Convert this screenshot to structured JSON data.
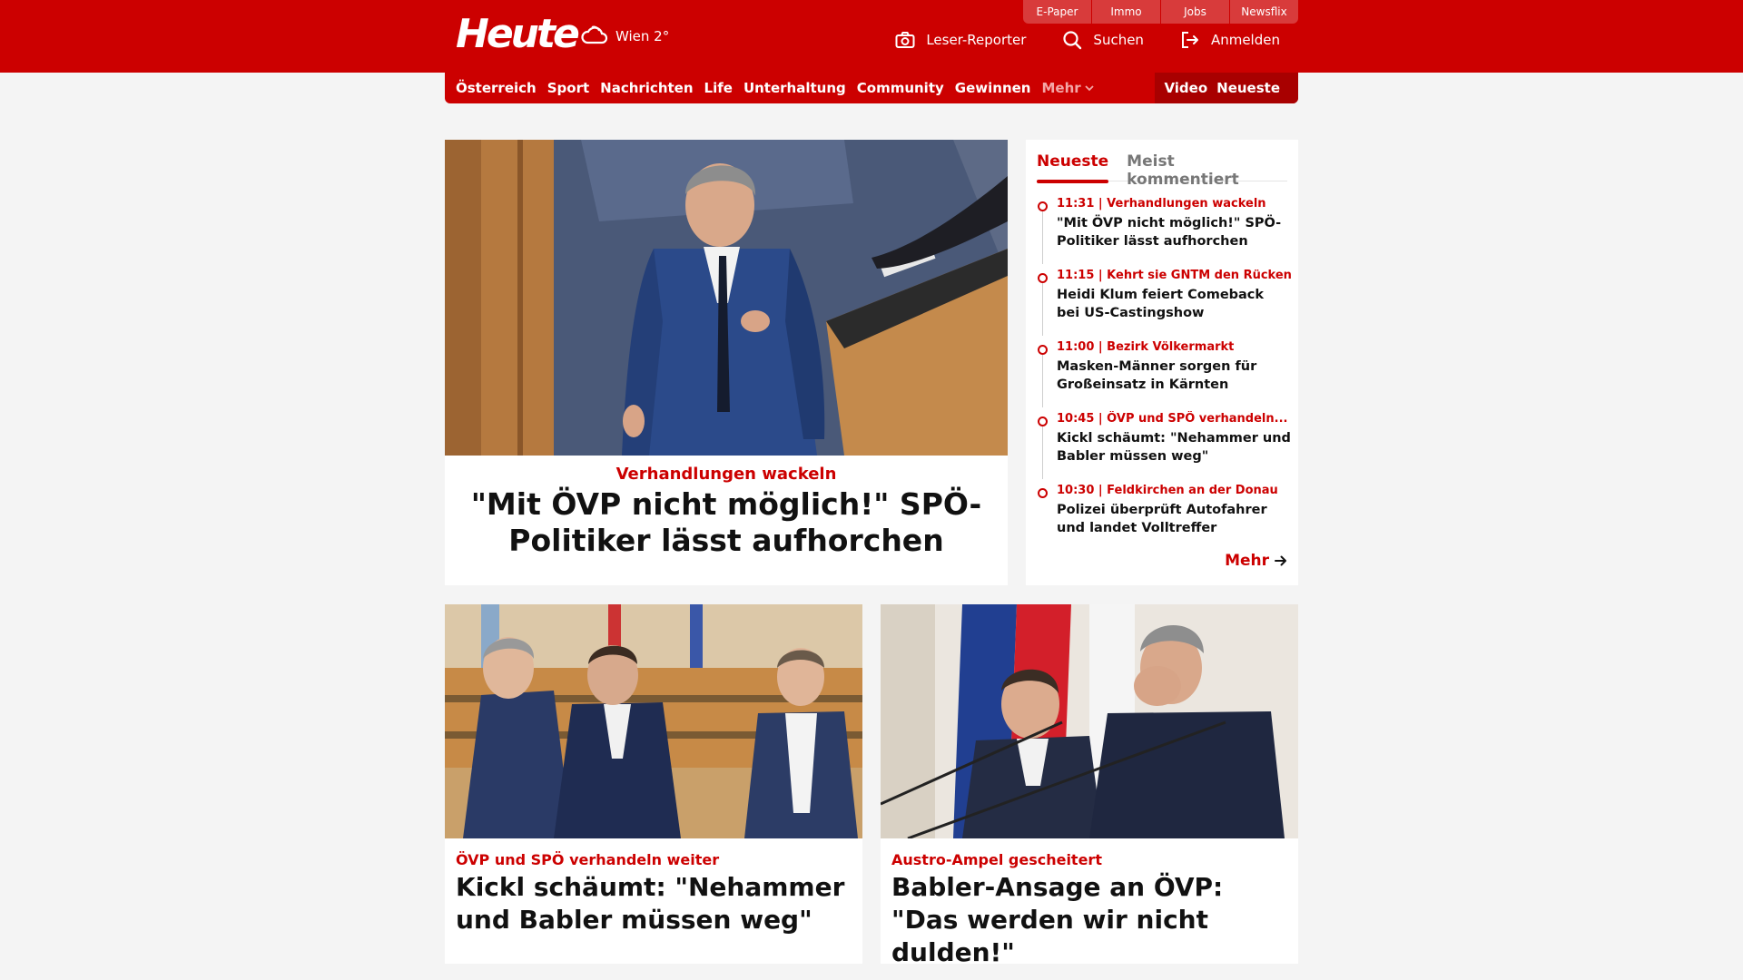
{
  "header": {
    "logo": "Heute",
    "weather": "Wien 2°",
    "service_tabs": [
      "E-Paper",
      "Immo",
      "Jobs",
      "Newsflix"
    ],
    "actions": {
      "reporter": "Leser-Reporter",
      "search": "Suchen",
      "login": "Anmelden"
    }
  },
  "nav": {
    "items": [
      "Österreich",
      "Sport",
      "Nachrichten",
      "Life",
      "Unterhaltung",
      "Community",
      "Gewinnen"
    ],
    "more": "Mehr",
    "right": [
      "Video",
      "Neueste"
    ]
  },
  "hero": {
    "kicker": "Verhandlungen wackeln",
    "title": "\"Mit ÖVP nicht möglich!\" SPÖ-Politiker lässt aufhorchen"
  },
  "sidebar": {
    "tabs": [
      "Neueste",
      "Meist kommentiert"
    ],
    "items": [
      {
        "meta": "11:31 | Verhandlungen wackeln",
        "title": "\"Mit ÖVP nicht möglich!\" SPÖ-Politiker lässt aufhorchen"
      },
      {
        "meta": "11:15 | Kehrt sie GNTM den Rücken?",
        "title": "Heidi Klum feiert Comeback bei US-Castingshow"
      },
      {
        "meta": "11:00 | Bezirk Völkermarkt",
        "title": "Masken-Männer sorgen für Großeinsatz in Kärnten"
      },
      {
        "meta": "10:45 | ÖVP und SPÖ verhandeln...",
        "title": "Kickl schäumt: \"Nehammer und Babler müssen weg\""
      },
      {
        "meta": "10:30 | Feldkirchen an der Donau",
        "title": "Polizei überprüft Autofahrer und landet Volltreffer"
      }
    ],
    "more": "Mehr"
  },
  "cards": [
    {
      "kicker": "ÖVP und SPÖ verhandeln weiter",
      "title": "Kickl schäumt: \"Nehammer und Babler müssen weg\""
    },
    {
      "kicker": "Austro-Ampel gescheitert",
      "title": "Babler-Ansage an ÖVP: \"Das werden wir nicht dulden!\""
    }
  ],
  "colors": {
    "brand": "#cc0000",
    "brand_dark": "#a80000",
    "background": "#f4f4f4"
  }
}
